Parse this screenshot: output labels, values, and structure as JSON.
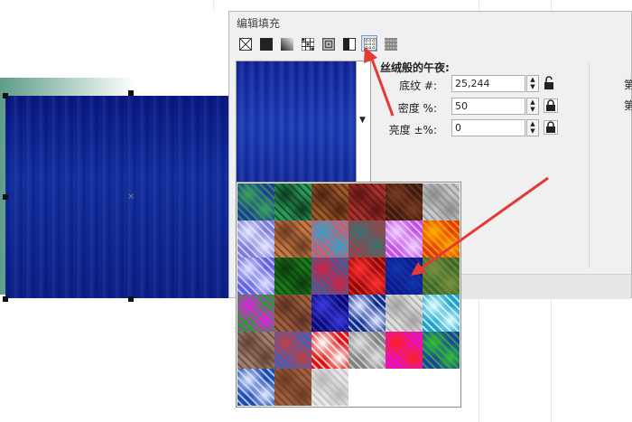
{
  "dialog": {
    "title": "编辑填充",
    "texture_name": "丝绒般的午夜:",
    "fields": [
      {
        "label": "底纹 #:",
        "value": "25,244"
      },
      {
        "label": "密度 %:",
        "value": "50"
      },
      {
        "label": "亮度 ±%:",
        "value": "0"
      }
    ],
    "right_labels": [
      "第",
      "第"
    ]
  },
  "toolbar_icons": [
    "no-fill-icon",
    "uniform-fill-icon",
    "fountain-fill-icon",
    "vector-pattern-icon",
    "bitmap-pattern-icon",
    "two-color-pattern-icon",
    "texture-fill-icon",
    "postscript-fill-icon"
  ],
  "texture_tiles": [
    [
      "#1f3e93",
      "#3aa35a"
    ],
    [
      "#2c9b5a",
      "#0e3a21"
    ],
    [
      "#9b5a2a",
      "#4c2310"
    ],
    [
      "#a8322c",
      "#5a1414"
    ],
    [
      "#3b1a10",
      "#7a3c20"
    ],
    [
      "#c8c8c8",
      "#8a8a8a"
    ],
    [
      "#7c7cd6",
      "#e7e7ff"
    ],
    [
      "#c87a48",
      "#6a3a20"
    ],
    [
      "#d35a6a",
      "#3aa0c8"
    ],
    [
      "#a04048",
      "#3a7070"
    ],
    [
      "#c050e0",
      "#f0d0ff"
    ],
    [
      "#e03a10",
      "#ffb000"
    ],
    [
      "#6060e0",
      "#e0e0ff"
    ],
    [
      "#1a7a1a",
      "#0c3a0c"
    ],
    [
      "#3a60a0",
      "#d02040"
    ],
    [
      "#8a0a0a",
      "#ff3030"
    ],
    [
      "#0a1a8a",
      "#1434ab"
    ],
    [
      "#3a6a2a",
      "#7a9040"
    ],
    [
      "#20a030",
      "#e020e0"
    ],
    [
      "#a06040",
      "#5a3020"
    ],
    [
      "#0a0a6a",
      "#3a3ae0"
    ],
    [
      "#0a2a8a",
      "#dfe6ff"
    ],
    [
      "#e0e0e0",
      "#a0a0a0"
    ],
    [
      "#20a0c8",
      "#e0ffff"
    ],
    [
      "#a08070",
      "#604030"
    ],
    [
      "#4060c0",
      "#c04040"
    ],
    [
      "#e01010",
      "#ffffff"
    ],
    [
      "#808080",
      "#e0e0e0"
    ],
    [
      "#e010e0",
      "#ff2020"
    ],
    [
      "#2040a0",
      "#30c030"
    ],
    [
      "#1a4ab0",
      "#e0e8ff"
    ],
    [
      "#a06040",
      "#6a3a20"
    ],
    [
      "#e8e8e8",
      "#b8b8b8"
    ]
  ]
}
